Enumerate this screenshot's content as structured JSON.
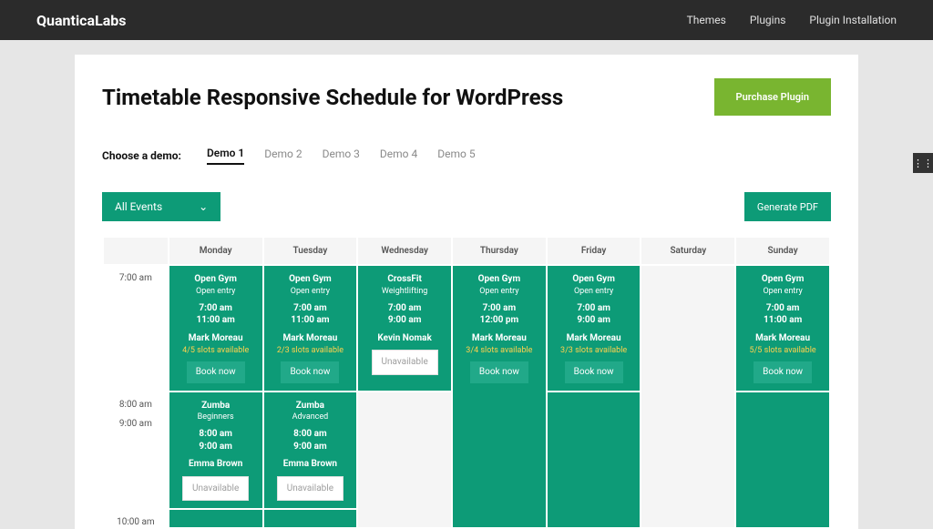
{
  "brand": "QuanticaLabs",
  "nav": {
    "themes": "Themes",
    "plugins": "Plugins",
    "install": "Plugin Installation"
  },
  "title": "Timetable Responsive Schedule for WordPress",
  "purchase": "Purchase Plugin",
  "demoLabel": "Choose a demo:",
  "demos": [
    "Demo 1",
    "Demo 2",
    "Demo 3",
    "Demo 4",
    "Demo 5"
  ],
  "filter": "All Events",
  "genpdf": "Generate PDF",
  "days": [
    "Monday",
    "Tuesday",
    "Wednesday",
    "Thursday",
    "Friday",
    "Saturday",
    "Sunday"
  ],
  "times": [
    "7:00 am",
    "8:00 am",
    "9:00 am",
    "10:00 am"
  ],
  "labels": {
    "book": "Book now",
    "unavail": "Unavailable"
  },
  "cells": {
    "mon7": {
      "title": "Open Gym",
      "sub": "Open entry",
      "t1": "7:00 am",
      "t2": "11:00 am",
      "instr": "Mark Moreau",
      "slots": "4/5 slots available",
      "action": "book"
    },
    "tue7": {
      "title": "Open Gym",
      "sub": "Open entry",
      "t1": "7:00 am",
      "t2": "11:00 am",
      "instr": "Mark Moreau",
      "slots": "2/3 slots available",
      "action": "book"
    },
    "wed7": {
      "title": "CrossFit",
      "sub": "Weightlifting",
      "t1": "7:00 am",
      "t2": "9:00 am",
      "instr": "Kevin Nomak",
      "slots": "",
      "action": "unavail"
    },
    "thu7": {
      "title": "Open Gym",
      "sub": "Open entry",
      "t1": "7:00 am",
      "t2": "12:00 pm",
      "instr": "Mark Moreau",
      "slots": "3/4 slots available",
      "action": "book"
    },
    "fri7": {
      "title": "Open Gym",
      "sub": "Open entry",
      "t1": "7:00 am",
      "t2": "9:00 am",
      "instr": "Mark Moreau",
      "slots": "3/3 slots available",
      "action": "book"
    },
    "sun7": {
      "title": "Open Gym",
      "sub": "Open entry",
      "t1": "7:00 am",
      "t2": "11:00 am",
      "instr": "Mark Moreau",
      "slots": "5/5 slots available",
      "action": "book"
    },
    "mon8": {
      "title": "Zumba",
      "sub": "Beginners",
      "t1": "8:00 am",
      "t2": "9:00 am",
      "instr": "Emma Brown",
      "slots": "",
      "action": "unavail2"
    },
    "tue8": {
      "title": "Zumba",
      "sub": "Advanced",
      "t1": "8:00 am",
      "t2": "9:00 am",
      "instr": "Emma Brown",
      "slots": "",
      "action": "unavail2"
    }
  }
}
